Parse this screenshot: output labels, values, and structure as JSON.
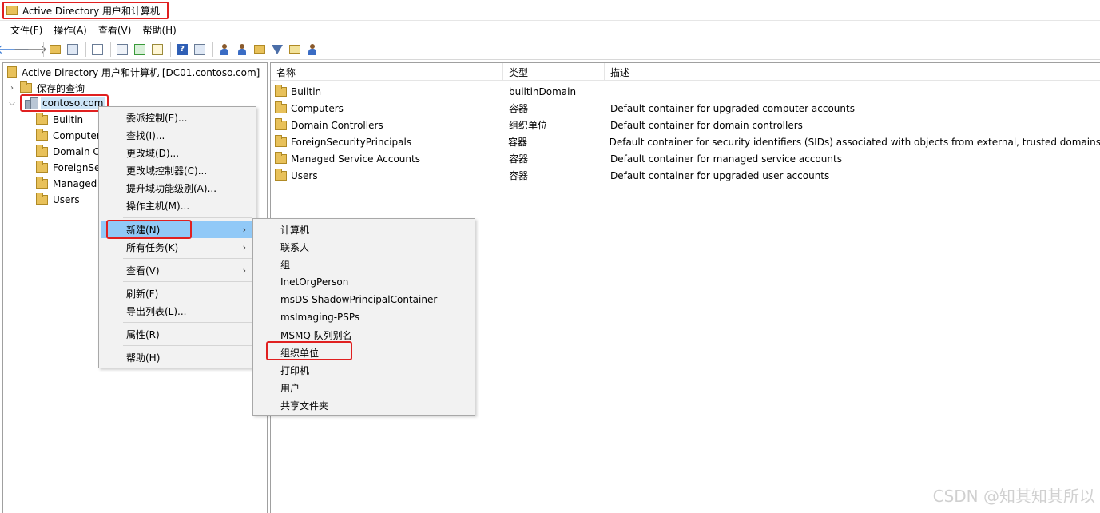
{
  "window": {
    "title": "Active Directory 用户和计算机"
  },
  "menu": [
    "文件(F)",
    "操作(A)",
    "查看(V)",
    "帮助(H)"
  ],
  "toolbar": {
    "buttons": [
      "back-arrow-icon",
      "forward-arrow-icon",
      "up-folder-icon",
      "show-console-tree-icon",
      "properties-icon",
      "export-list-icon",
      "refresh-icon",
      "export-icon",
      "help-icon",
      "action-pane-icon",
      "new-user-icon",
      "new-group-icon",
      "new-ou-icon",
      "filter-icon",
      "find-icon",
      "add-to-group-icon"
    ]
  },
  "tree": {
    "root": "Active Directory 用户和计算机 [DC01.contoso.com]",
    "saved_queries": "保存的查询",
    "domain": "contoso.com",
    "children": [
      "Builtin",
      "Computers",
      "Domain Controllers",
      "ForeignSecurityPrincipals",
      "Managed Service Accounts",
      "Users"
    ]
  },
  "list": {
    "headers": {
      "name": "名称",
      "type": "类型",
      "desc": "描述"
    },
    "rows": [
      {
        "name": "Builtin",
        "type": "builtinDomain",
        "desc": ""
      },
      {
        "name": "Computers",
        "type": "容器",
        "desc": "Default container for upgraded computer accounts"
      },
      {
        "name": "Domain Controllers",
        "type": "组织单位",
        "desc": "Default container for domain controllers"
      },
      {
        "name": "ForeignSecurityPrincipals",
        "type": "容器",
        "desc": "Default container for security identifiers (SIDs) associated with objects from external, trusted domains"
      },
      {
        "name": "Managed Service Accounts",
        "type": "容器",
        "desc": "Default container for managed service accounts"
      },
      {
        "name": "Users",
        "type": "容器",
        "desc": "Default container for upgraded user accounts"
      }
    ]
  },
  "context_menu": {
    "items": [
      "委派控制(E)...",
      "查找(I)...",
      "更改域(D)...",
      "更改域控制器(C)...",
      "提升域功能级别(A)...",
      "操作主机(M)...",
      "新建(N)",
      "所有任务(K)",
      "查看(V)",
      "刷新(F)",
      "导出列表(L)...",
      "属性(R)",
      "帮助(H)"
    ]
  },
  "submenu": {
    "items": [
      "计算机",
      "联系人",
      "组",
      "InetOrgPerson",
      "msDS-ShadowPrincipalContainer",
      "msImaging-PSPs",
      "MSMQ 队列别名",
      "组织单位",
      "打印机",
      "用户",
      "共享文件夹"
    ]
  },
  "watermark": "CSDN @知其知其所以"
}
